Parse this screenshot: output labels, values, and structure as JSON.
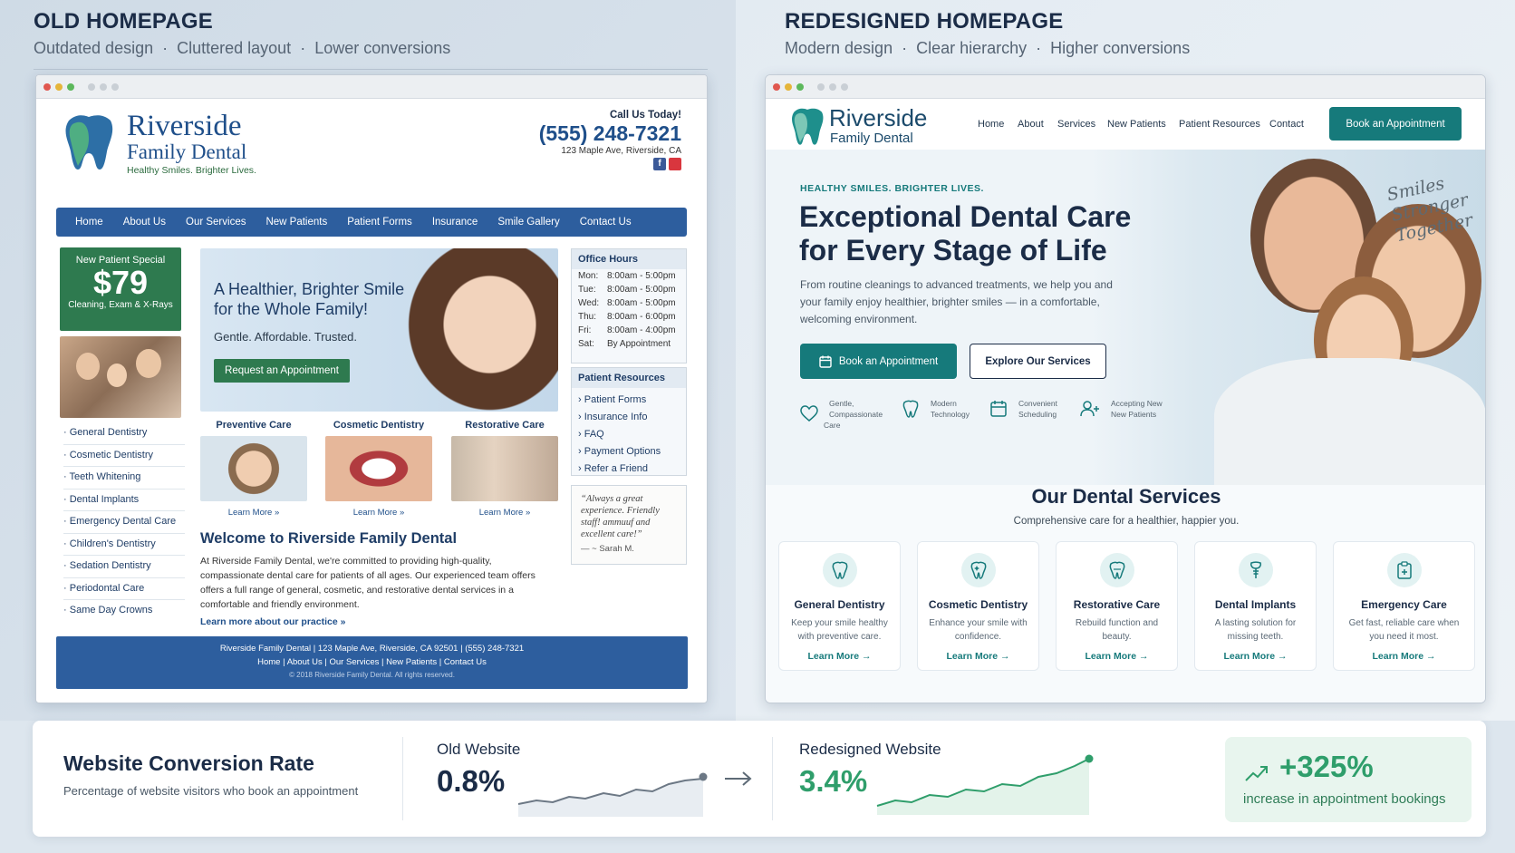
{
  "old": {
    "heading": "OLD HOMEPAGE",
    "subheading": [
      "Outdated design",
      "Cluttered layout",
      "Lower conversions"
    ],
    "logo": {
      "line1": "Riverside",
      "line2": "Family Dental",
      "tagline": "Healthy Smiles. Brighter Lives."
    },
    "call": {
      "label": "Call Us Today!",
      "phone": "(555) 248-7321",
      "address": "123 Maple Ave, Riverside, CA"
    },
    "nav": [
      "Home",
      "About Us",
      "Our Services",
      "New Patients",
      "Patient Forms",
      "Insurance",
      "Smile Gallery",
      "Contact Us"
    ],
    "special": {
      "title": "New Patient Special",
      "price": "$79",
      "desc": "Cleaning, Exam & X-Rays"
    },
    "services_list": [
      "General Dentistry",
      "Cosmetic Dentistry",
      "Teeth Whitening",
      "Dental Implants",
      "Emergency Dental Care",
      "Children's Dentistry",
      "Sedation Dentistry",
      "Periodontal Care",
      "Same Day Crowns"
    ],
    "hero": {
      "title_line1": "A Healthier, Brighter Smile",
      "title_line2": "for the Whole Family!",
      "sub": "Gentle. Affordable. Trusted.",
      "button": "Request an Appointment"
    },
    "cards": [
      {
        "title": "Preventive Care",
        "link": "Learn More »"
      },
      {
        "title": "Cosmetic Dentistry",
        "link": "Learn More »"
      },
      {
        "title": "Restorative Care",
        "link": "Learn More »"
      }
    ],
    "welcome": {
      "title": "Welcome to Riverside Family Dental",
      "body": "At Riverside Family Dental, we're committed to providing high-quality, compassionate dental care for patients of all ages. Our experienced team offers offers a full range of general, cosmetic, and restorative dental services in a comfortable and friendly environment.",
      "link": "Learn more about our practice »"
    },
    "hours": {
      "title": "Office Hours",
      "rows": [
        {
          "day": "Mon:",
          "time": "8:00am - 5:00pm"
        },
        {
          "day": "Tue:",
          "time": "8:00am - 5:00pm"
        },
        {
          "day": "Wed:",
          "time": "8:00am - 5:00pm"
        },
        {
          "day": "Thu:",
          "time": "8:00am - 6:00pm"
        },
        {
          "day": "Fri:",
          "time": "8:00am - 4:00pm"
        },
        {
          "day": "Sat:",
          "time": "By Appointment"
        }
      ]
    },
    "resources": {
      "title": "Patient Resources",
      "items": [
        "Patient Forms",
        "Insurance Info",
        "FAQ",
        "Payment Options",
        "Refer a Friend"
      ]
    },
    "testimonial": {
      "quote": "“Always a great experience. Friendly staff! ammuuf and excellent care!”",
      "author": "— ~ Sarah M."
    },
    "footer": {
      "line1": "Riverside Family Dental | 123 Maple Ave, Riverside, CA 92501 | (555) 248-7321",
      "line2": "Home | About Us | Our Services | New Patients | Contact Us",
      "line3": "© 2018 Riverside Family Dental. All rights reserved."
    }
  },
  "new": {
    "heading": "REDESIGNED HOMEPAGE",
    "subheading": [
      "Modern design",
      "Clear hierarchy",
      "Higher conversions"
    ],
    "logo": {
      "line1": "Riverside",
      "line2": "Family Dental"
    },
    "nav": [
      "Home",
      "About",
      "Services",
      "New Patients",
      "Patient Resources",
      "Contact"
    ],
    "cta": "Book an Appointment",
    "hero": {
      "eyebrow": "HEALTHY SMILES. BRIGHTER LIVES.",
      "title_line1": "Exceptional Dental Care",
      "title_line2": "for Every Stage of Life",
      "body": "From routine cleanings to advanced treatments, we help you and your family enjoy healthier, brighter smiles — in a comfortable, welcoming environment.",
      "btn_primary": "Book an Appointment",
      "btn_secondary": "Explore Our Services",
      "script_lines": [
        "Smiles",
        "Stronger",
        "Together"
      ]
    },
    "features": [
      {
        "icon": "heart-icon",
        "line1": "Gentle,",
        "line2": "Compassionate Care"
      },
      {
        "icon": "tooth-icon",
        "line1": "Modern",
        "line2": "Technology"
      },
      {
        "icon": "calendar-icon",
        "line1": "Convenient",
        "line2": "Scheduling"
      },
      {
        "icon": "users-icon",
        "line1": "Accepting New",
        "line2": "New Patients"
      }
    ],
    "services": {
      "title": "Our Dental Services",
      "sub": "Comprehensive care for a healthier, happier you.",
      "items": [
        {
          "icon": "tooth-icon",
          "title": "General Dentistry",
          "desc": "Keep your smile healthy with preventive care.",
          "link": "Learn More →"
        },
        {
          "icon": "sparkle-tooth-icon",
          "title": "Cosmetic Dentistry",
          "desc": "Enhance your smile with confidence.",
          "link": "Learn More →"
        },
        {
          "icon": "restore-tooth-icon",
          "title": "Restorative Care",
          "desc": "Rebuild function and beauty.",
          "link": "Learn More →"
        },
        {
          "icon": "implant-icon",
          "title": "Dental Implants",
          "desc": "A lasting solution for missing teeth.",
          "link": "Learn More →"
        },
        {
          "icon": "clipboard-icon",
          "title": "Emergency Care",
          "desc": "Get fast, reliable care when you need it most.",
          "link": "Learn More →"
        }
      ]
    }
  },
  "conversion": {
    "title": "Website Conversion Rate",
    "sub": "Percentage of website visitors who book an appointment",
    "old_label": "Old Website",
    "old_value": "0.8%",
    "new_label": "Redesigned Website",
    "new_value": "3.4%",
    "lift": "+325%",
    "lift_label": "increase in appointment bookings"
  },
  "colors": {
    "old_blue": "#2d5e9e",
    "teal": "#167a7b",
    "green": "#2f9e6b",
    "navy": "#1b2c47"
  }
}
